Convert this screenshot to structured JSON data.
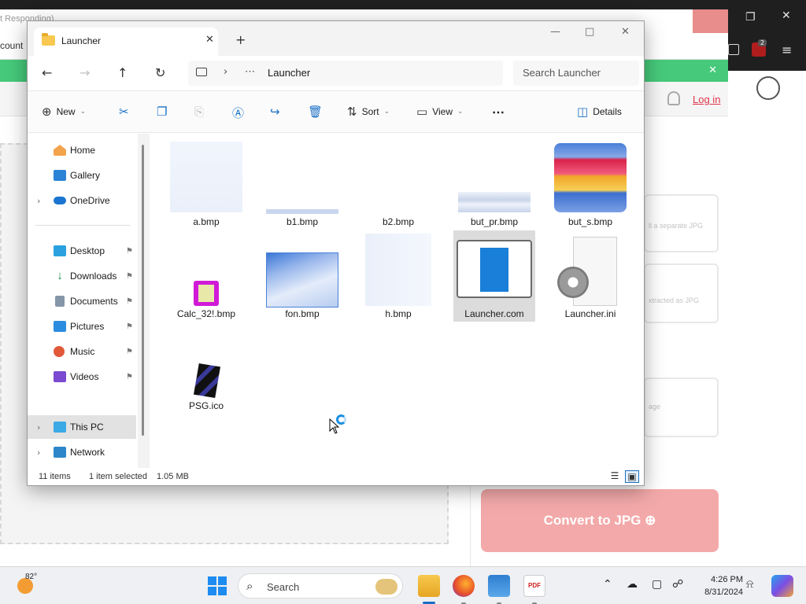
{
  "background": {
    "window_title": "t Responding)",
    "account_text": "count",
    "login_label": "Log in",
    "option_1_text": "ll a separate JPG",
    "option_2_text": "xtracted as JPG",
    "option_3_text": "age",
    "convert_button": "Convert to JPG",
    "tab_badge": "2"
  },
  "explorer": {
    "tab_title": "Launcher",
    "address": {
      "current": "Launcher",
      "overflow": "⋯"
    },
    "search_placeholder": "Search Launcher",
    "toolbar": {
      "new_label": "New",
      "sort_label": "Sort",
      "view_label": "View",
      "more_label": "⋯",
      "details_label": "Details"
    },
    "sidebar": {
      "items": [
        {
          "label": "Home",
          "icon": "home-icon"
        },
        {
          "label": "Gallery",
          "icon": "gallery-icon"
        },
        {
          "label": "OneDrive",
          "icon": "cloud-icon"
        },
        {
          "label": "Desktop",
          "icon": "desktop-icon"
        },
        {
          "label": "Downloads",
          "icon": "download-icon"
        },
        {
          "label": "Documents",
          "icon": "documents-icon"
        },
        {
          "label": "Pictures",
          "icon": "pictures-icon"
        },
        {
          "label": "Music",
          "icon": "music-icon"
        },
        {
          "label": "Videos",
          "icon": "videos-icon"
        },
        {
          "label": "This PC",
          "icon": "computer-icon"
        },
        {
          "label": "Network",
          "icon": "network-icon"
        }
      ]
    },
    "files": [
      {
        "name": "a.bmp"
      },
      {
        "name": "b1.bmp"
      },
      {
        "name": "b2.bmp"
      },
      {
        "name": "but_pr.bmp"
      },
      {
        "name": "but_s.bmp"
      },
      {
        "name": "Calc_32!.bmp"
      },
      {
        "name": "fon.bmp"
      },
      {
        "name": "h.bmp"
      },
      {
        "name": "Launcher.com"
      },
      {
        "name": "Launcher.ini"
      },
      {
        "name": "PSG.ico"
      }
    ],
    "status": {
      "item_count": "11 items",
      "selection": "1 item selected",
      "size": "1.05 MB"
    }
  },
  "taskbar": {
    "temperature": "82°",
    "search_label": "Search",
    "time": "4:26 PM",
    "date": "8/31/2024",
    "pdf_label": "PDF"
  },
  "colors": {
    "accent": "#1a6fc4",
    "green_bar": "#46c97a",
    "convert_button": "#f3a9a9",
    "login": "#e0334a"
  }
}
